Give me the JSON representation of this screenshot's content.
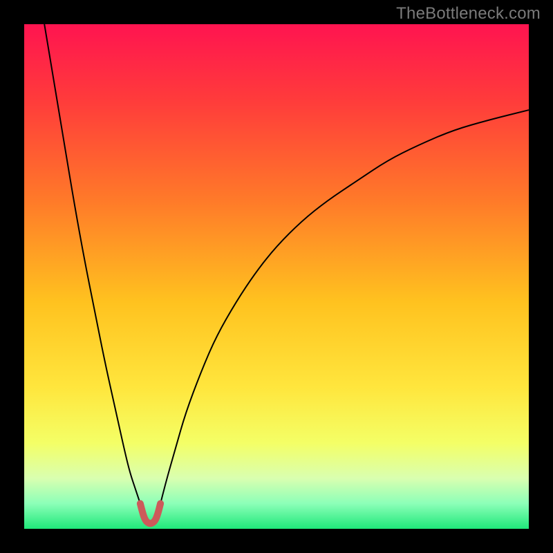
{
  "watermark": "TheBottleneck.com",
  "chart_data": {
    "type": "line",
    "title": "",
    "xlabel": "",
    "ylabel": "",
    "xlim": [
      0,
      100
    ],
    "ylim": [
      0,
      100
    ],
    "grid": false,
    "legend": false,
    "annotations": [],
    "background_gradient": {
      "type": "vertical",
      "stops": [
        {
          "offset": 0.0,
          "color": "#ff1450"
        },
        {
          "offset": 0.15,
          "color": "#ff3b3b"
        },
        {
          "offset": 0.35,
          "color": "#ff7a29"
        },
        {
          "offset": 0.55,
          "color": "#ffc21f"
        },
        {
          "offset": 0.72,
          "color": "#ffe63d"
        },
        {
          "offset": 0.83,
          "color": "#f4ff66"
        },
        {
          "offset": 0.9,
          "color": "#d9ffb0"
        },
        {
          "offset": 0.95,
          "color": "#8cffb8"
        },
        {
          "offset": 1.0,
          "color": "#1fe87a"
        }
      ]
    },
    "series": [
      {
        "name": "left-branch",
        "color": "#000000",
        "width": 2,
        "x": [
          4,
          6,
          8,
          10,
          12,
          14,
          16,
          18,
          20,
          21,
          22,
          23
        ],
        "y": [
          100,
          88,
          76,
          64,
          53,
          43,
          33,
          24,
          15,
          11,
          8,
          5
        ]
      },
      {
        "name": "right-branch",
        "color": "#000000",
        "width": 2,
        "x": [
          27,
          28,
          30,
          32,
          35,
          38,
          42,
          46,
          50,
          55,
          60,
          66,
          72,
          78,
          85,
          92,
          100
        ],
        "y": [
          5,
          9,
          16,
          23,
          31,
          38,
          45,
          51,
          56,
          61,
          65,
          69,
          73,
          76,
          79,
          81,
          83
        ]
      },
      {
        "name": "valley-marker",
        "color": "#cc5a5a",
        "width": 10,
        "shape": "u",
        "x": [
          23,
          23.5,
          24,
          24.5,
          25,
          25.5,
          26,
          26.5,
          27
        ],
        "y": [
          5,
          3,
          1.7,
          1.2,
          1,
          1.2,
          1.7,
          3,
          5
        ]
      }
    ],
    "valley_x": 25,
    "valley_y": 1
  }
}
